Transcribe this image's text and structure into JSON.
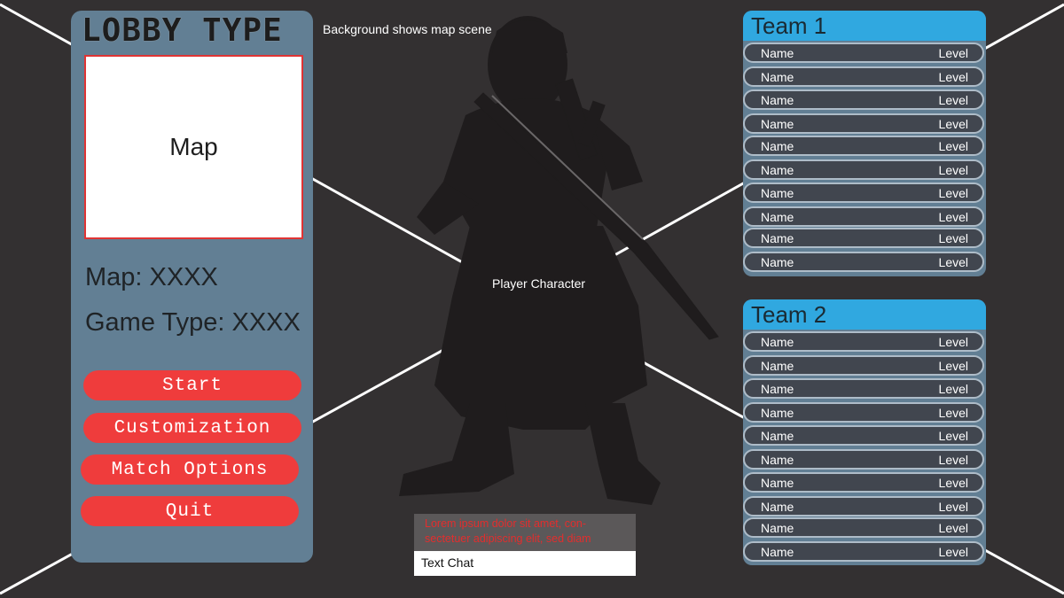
{
  "lobby": {
    "title": "LOBBY TYPE",
    "map_preview_label": "Map",
    "map_line": "Map: XXXX",
    "game_type_line": "Game Type: XXXX",
    "buttons": [
      "Start",
      "Customization",
      "Match Options",
      "Quit"
    ]
  },
  "scene": {
    "background_note": "Background shows map scene",
    "character_label": "Player Character"
  },
  "chat": {
    "log_text": "Lorem ipsum dolor sit amet, con- sectetuer adipiscing elit, sed diam",
    "input_label": "Text Chat"
  },
  "teams": [
    {
      "name": "Team 1",
      "players": [
        {
          "name": "Name",
          "level": "Level"
        },
        {
          "name": "Name",
          "level": "Level"
        },
        {
          "name": "Name",
          "level": "Level"
        },
        {
          "name": "Name",
          "level": "Level"
        },
        {
          "name": "Name",
          "level": "Level"
        },
        {
          "name": "Name",
          "level": "Level"
        },
        {
          "name": "Name",
          "level": "Level"
        },
        {
          "name": "Name",
          "level": "Level"
        },
        {
          "name": "Name",
          "level": "Level"
        },
        {
          "name": "Name",
          "level": "Level"
        }
      ]
    },
    {
      "name": "Team 2",
      "players": [
        {
          "name": "Name",
          "level": "Level"
        },
        {
          "name": "Name",
          "level": "Level"
        },
        {
          "name": "Name",
          "level": "Level"
        },
        {
          "name": "Name",
          "level": "Level"
        },
        {
          "name": "Name",
          "level": "Level"
        },
        {
          "name": "Name",
          "level": "Level"
        },
        {
          "name": "Name",
          "level": "Level"
        },
        {
          "name": "Name",
          "level": "Level"
        },
        {
          "name": "Name",
          "level": "Level"
        },
        {
          "name": "Name",
          "level": "Level"
        }
      ]
    }
  ],
  "colors": {
    "background": "#333031",
    "panel": "#627f94",
    "team_header": "#30a8e0",
    "button": "#ef3c3c",
    "chat_text": "#e32d2d"
  }
}
